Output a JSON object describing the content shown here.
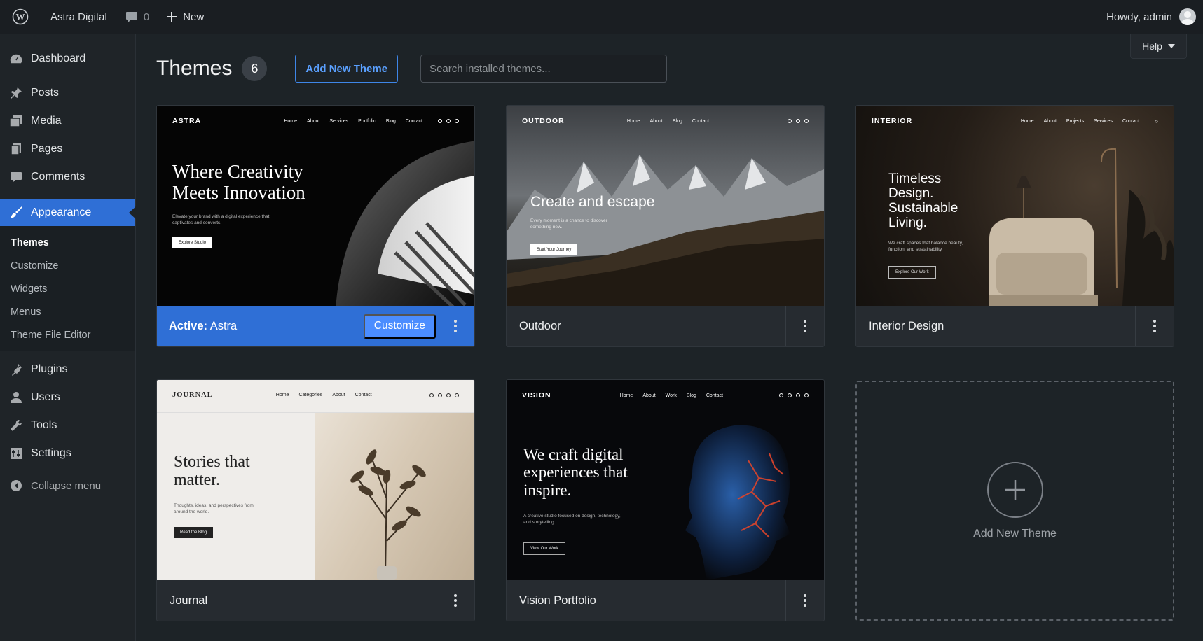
{
  "adminbar": {
    "site_name": "Astra Digital",
    "comments_count": "0",
    "new_label": "New",
    "howdy": "Howdy, admin"
  },
  "sidebar": {
    "items": [
      {
        "label": "Dashboard",
        "icon": "dashboard-icon"
      },
      {
        "label": "Posts",
        "icon": "pin-icon"
      },
      {
        "label": "Media",
        "icon": "media-icon"
      },
      {
        "label": "Pages",
        "icon": "pages-icon"
      },
      {
        "label": "Comments",
        "icon": "comment-icon"
      },
      {
        "label": "Appearance",
        "icon": "brush-icon"
      },
      {
        "label": "Plugins",
        "icon": "plug-icon"
      },
      {
        "label": "Users",
        "icon": "user-icon"
      },
      {
        "label": "Tools",
        "icon": "wrench-icon"
      },
      {
        "label": "Settings",
        "icon": "settings-icon"
      }
    ],
    "submenu": [
      "Themes",
      "Customize",
      "Widgets",
      "Menus",
      "Theme File Editor"
    ],
    "collapse": "Collapse menu"
  },
  "header": {
    "help": "Help",
    "title": "Themes",
    "count": "6",
    "add_new": "Add New Theme",
    "search_placeholder": "Search installed themes..."
  },
  "themes": [
    {
      "name": "Astra",
      "active_prefix": "Active:",
      "customize": "Customize",
      "logo": "ASTRA",
      "nav": [
        "Home",
        "About",
        "Services",
        "Portfolio",
        "Blog",
        "Contact"
      ],
      "hero": "Where Creativity Meets Innovation",
      "para": "Elevate your brand with a digital experience that captivates and converts.",
      "button": "Explore Studio"
    },
    {
      "name": "Outdoor",
      "logo": "OUTDOOR",
      "nav": [
        "Home",
        "About",
        "Blog",
        "Contact"
      ],
      "hero": "Create and escape",
      "para": "Every moment is a chance to discover something new.",
      "button": "Start Your Journey"
    },
    {
      "name": "Interior Design",
      "logo": "INTERIOR",
      "nav": [
        "Home",
        "About",
        "Projects",
        "Services",
        "Contact"
      ],
      "hero": "Timeless Design. Sustainable Living.",
      "para": "We craft spaces that balance beauty, function, and sustainability.",
      "button": "Explore Our Work"
    },
    {
      "name": "Journal",
      "logo": "JOURNAL",
      "nav": [
        "Home",
        "Categories",
        "About",
        "Contact"
      ],
      "hero": "Stories that matter.",
      "para": "Thoughts, ideas, and perspectives from around the world.",
      "button": "Read the Blog"
    },
    {
      "name": "Vision Portfolio",
      "logo": "VISION",
      "nav": [
        "Home",
        "About",
        "Work",
        "Blog",
        "Contact"
      ],
      "hero": "We craft digital experiences that inspire.",
      "para": "A creative studio focused on design, technology, and storytelling.",
      "button": "View Our Work"
    }
  ],
  "add_tile_label": "Add New Theme",
  "colors": {
    "accent": "#2f6fd6",
    "link": "#5aa0ff"
  }
}
